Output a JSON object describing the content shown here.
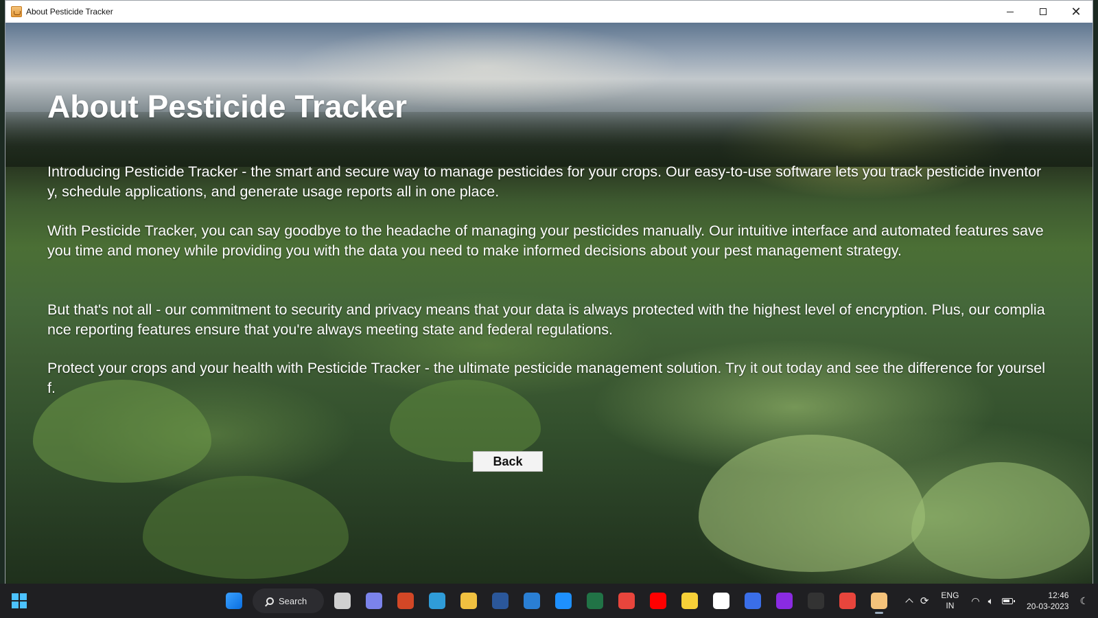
{
  "window": {
    "title": "About Pesticide Tracker"
  },
  "content": {
    "heading": "About Pesticide Tracker",
    "paragraphs": [
      "Introducing Pesticide Tracker - the smart and secure way to manage pesticides for your crops. Our easy-to-use software lets you track pesticide inventory, schedule applications, and generate usage reports all in one place.",
      "With Pesticide Tracker, you can say goodbye to the headache of managing your pesticides manually. Our intuitive interface and automated features save you time and money while providing you with the data you need to make informed decisions about your pest management strategy.",
      "But that's not all - our commitment to security and privacy means that your data is always protected with the highest level of encryption. Plus, our compliance reporting features ensure that you're always meeting state and federal regulations.",
      "Protect your crops and your health with Pesticide Tracker - the ultimate pesticide management solution. Try it out today and see the difference for yourself."
    ],
    "back_label": "Back"
  },
  "taskbar": {
    "search_label": "Search",
    "apps": [
      {
        "name": "task-view-icon",
        "color": "#d0d0d0"
      },
      {
        "name": "chat-icon",
        "color": "#7b83eb"
      },
      {
        "name": "powerpoint-icon",
        "color": "#d24726"
      },
      {
        "name": "edge-icon",
        "color": "#2f9cd8"
      },
      {
        "name": "file-explorer-icon",
        "color": "#f0c040"
      },
      {
        "name": "word-icon",
        "color": "#2b579a"
      },
      {
        "name": "mail-icon",
        "color": "#2a7fd4"
      },
      {
        "name": "browser-icon",
        "color": "#1e90ff"
      },
      {
        "name": "excel-icon",
        "color": "#217346"
      },
      {
        "name": "chrome-icon",
        "color": "#e8453c"
      },
      {
        "name": "youtube-icon",
        "color": "#ff0000"
      },
      {
        "name": "sticky-notes-icon",
        "color": "#f7d038"
      },
      {
        "name": "notion-icon",
        "color": "#ffffff"
      },
      {
        "name": "app-w-icon",
        "color": "#3a6ee8"
      },
      {
        "name": "intellij-icon",
        "color": "#8a2be2"
      },
      {
        "name": "terminal-icon",
        "color": "#333333"
      },
      {
        "name": "chrome-profile-icon",
        "color": "#e8453c"
      },
      {
        "name": "java-app-icon",
        "color": "#f4c27a"
      }
    ],
    "lang_line1": "ENG",
    "lang_line2": "IN",
    "time": "12:46",
    "date": "20-03-2023"
  }
}
